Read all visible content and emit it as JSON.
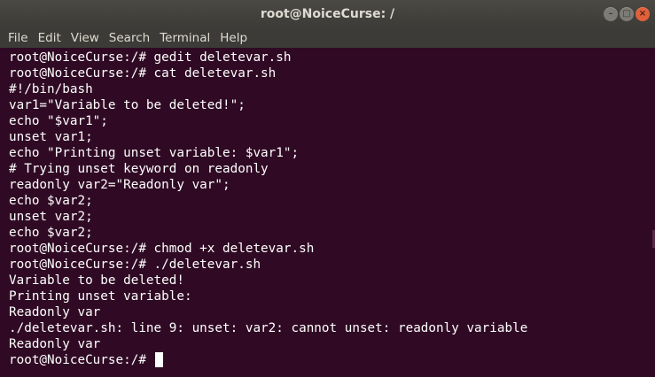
{
  "window": {
    "title": "root@NoiceCurse: /",
    "controls": {
      "minimize": "–",
      "maximize": "□",
      "close": "×"
    }
  },
  "menu": {
    "items": [
      "File",
      "Edit",
      "View",
      "Search",
      "Terminal",
      "Help"
    ]
  },
  "terminal": {
    "lines": [
      "root@NoiceCurse:/# gedit deletevar.sh",
      "root@NoiceCurse:/# cat deletevar.sh",
      "#!/bin/bash",
      "var1=\"Variable to be deleted!\";",
      "echo \"$var1\";",
      "unset var1;",
      "echo \"Printing unset variable: $var1\";",
      "# Trying unset keyword on readonly",
      "readonly var2=\"Readonly var\";",
      "echo $var2;",
      "unset var2;",
      "echo $var2;",
      "root@NoiceCurse:/# chmod +x deletevar.sh",
      "root@NoiceCurse:/# ./deletevar.sh",
      "Variable to be deleted!",
      "Printing unset variable:",
      "Readonly var",
      "./deletevar.sh: line 9: unset: var2: cannot unset: readonly variable",
      "Readonly var"
    ],
    "prompt": "root@NoiceCurse:/# "
  },
  "colors": {
    "background": "#300a24",
    "text": "#ffffff",
    "titlebar": "#3c3b37",
    "close_button": "#e0603c"
  }
}
